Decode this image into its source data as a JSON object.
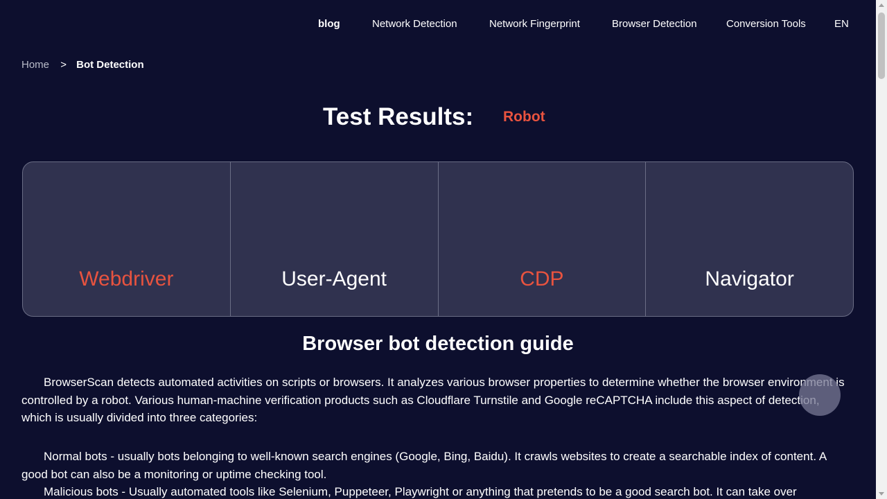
{
  "nav": {
    "items": [
      "blog",
      "Network Detection",
      "Network Fingerprint",
      "Browser Detection",
      "Conversion Tools",
      "EN"
    ]
  },
  "breadcrumb": {
    "home": "Home",
    "separator": ">",
    "current": "Bot Detection"
  },
  "results": {
    "title": "Test Results:",
    "value": "Robot",
    "value_color": "#e8533f"
  },
  "cards": [
    {
      "label": "Webdriver",
      "color": "#e8533f"
    },
    {
      "label": "User-Agent",
      "color": "#ffffff"
    },
    {
      "label": "CDP",
      "color": "#e8533f"
    },
    {
      "label": "Navigator",
      "color": "#ffffff"
    }
  ],
  "guide": {
    "title": "Browser bot detection guide",
    "paragraphs": [
      "BrowserScan detects automated activities on scripts or browsers. It analyzes various browser properties to determine whether the browser environment is controlled by a robot. Various human-machine verification products such as Cloudflare Turnstile and Google reCAPTCHA include this aspect of detection, which is usually divided into three categories:",
      "Normal bots - usually bots belonging to well-known search engines (Google, Bing, Baidu). It crawls websites to create a searchable index of content. A good bot can also be a monitoring or uptime checking tool.",
      "Malicious bots - Usually automated tools like Selenium, Puppeteer, Playwright or anything that pretends to be a good search bot. It can take over"
    ]
  },
  "colors": {
    "background": "#0d0f2e",
    "card_background": "#30324f",
    "accent_red": "#e8533f"
  }
}
